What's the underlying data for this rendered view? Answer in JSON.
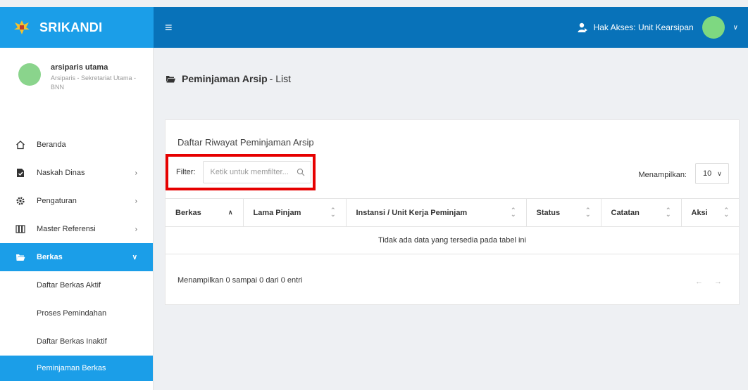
{
  "brand": {
    "title": "SRIKANDI"
  },
  "header": {
    "access_text": "Hak Akses: Unit Kearsipan"
  },
  "profile": {
    "name": "arsiparis utama",
    "role": "Arsiparis - Sekretariat Utama - BNN"
  },
  "sidebar": {
    "items": [
      {
        "label": "Beranda"
      },
      {
        "label": "Naskah Dinas"
      },
      {
        "label": "Pengaturan"
      },
      {
        "label": "Master Referensi"
      },
      {
        "label": "Berkas"
      }
    ],
    "submenu": [
      {
        "label": "Daftar Berkas Aktif"
      },
      {
        "label": "Proses Pemindahan"
      },
      {
        "label": "Daftar Berkas Inaktif"
      },
      {
        "label": "Peminjaman Berkas"
      }
    ]
  },
  "page": {
    "title": "Peminjaman Arsip",
    "subtitle": "- List"
  },
  "card": {
    "title": "Daftar Riwayat Peminjaman Arsip",
    "filter_label": "Filter:",
    "filter_placeholder": "Ketik untuk memfilter...",
    "show_label": "Menampilkan:",
    "show_value": "10",
    "columns": [
      {
        "label": "Berkas"
      },
      {
        "label": "Lama Pinjam"
      },
      {
        "label": "Instansi / Unit Kerja Peminjam"
      },
      {
        "label": "Status"
      },
      {
        "label": "Catatan"
      },
      {
        "label": "Aksi"
      }
    ],
    "empty_text": "Tidak ada data yang tersedia pada tabel ini",
    "info_text": "Menampilkan 0 sampai 0 dari 0 entri",
    "pager": {
      "prev": "←",
      "next": "→"
    }
  },
  "colors": {
    "brand": "#1b9ee8",
    "navbar": "#0872b9",
    "highlight": "#e60000"
  }
}
